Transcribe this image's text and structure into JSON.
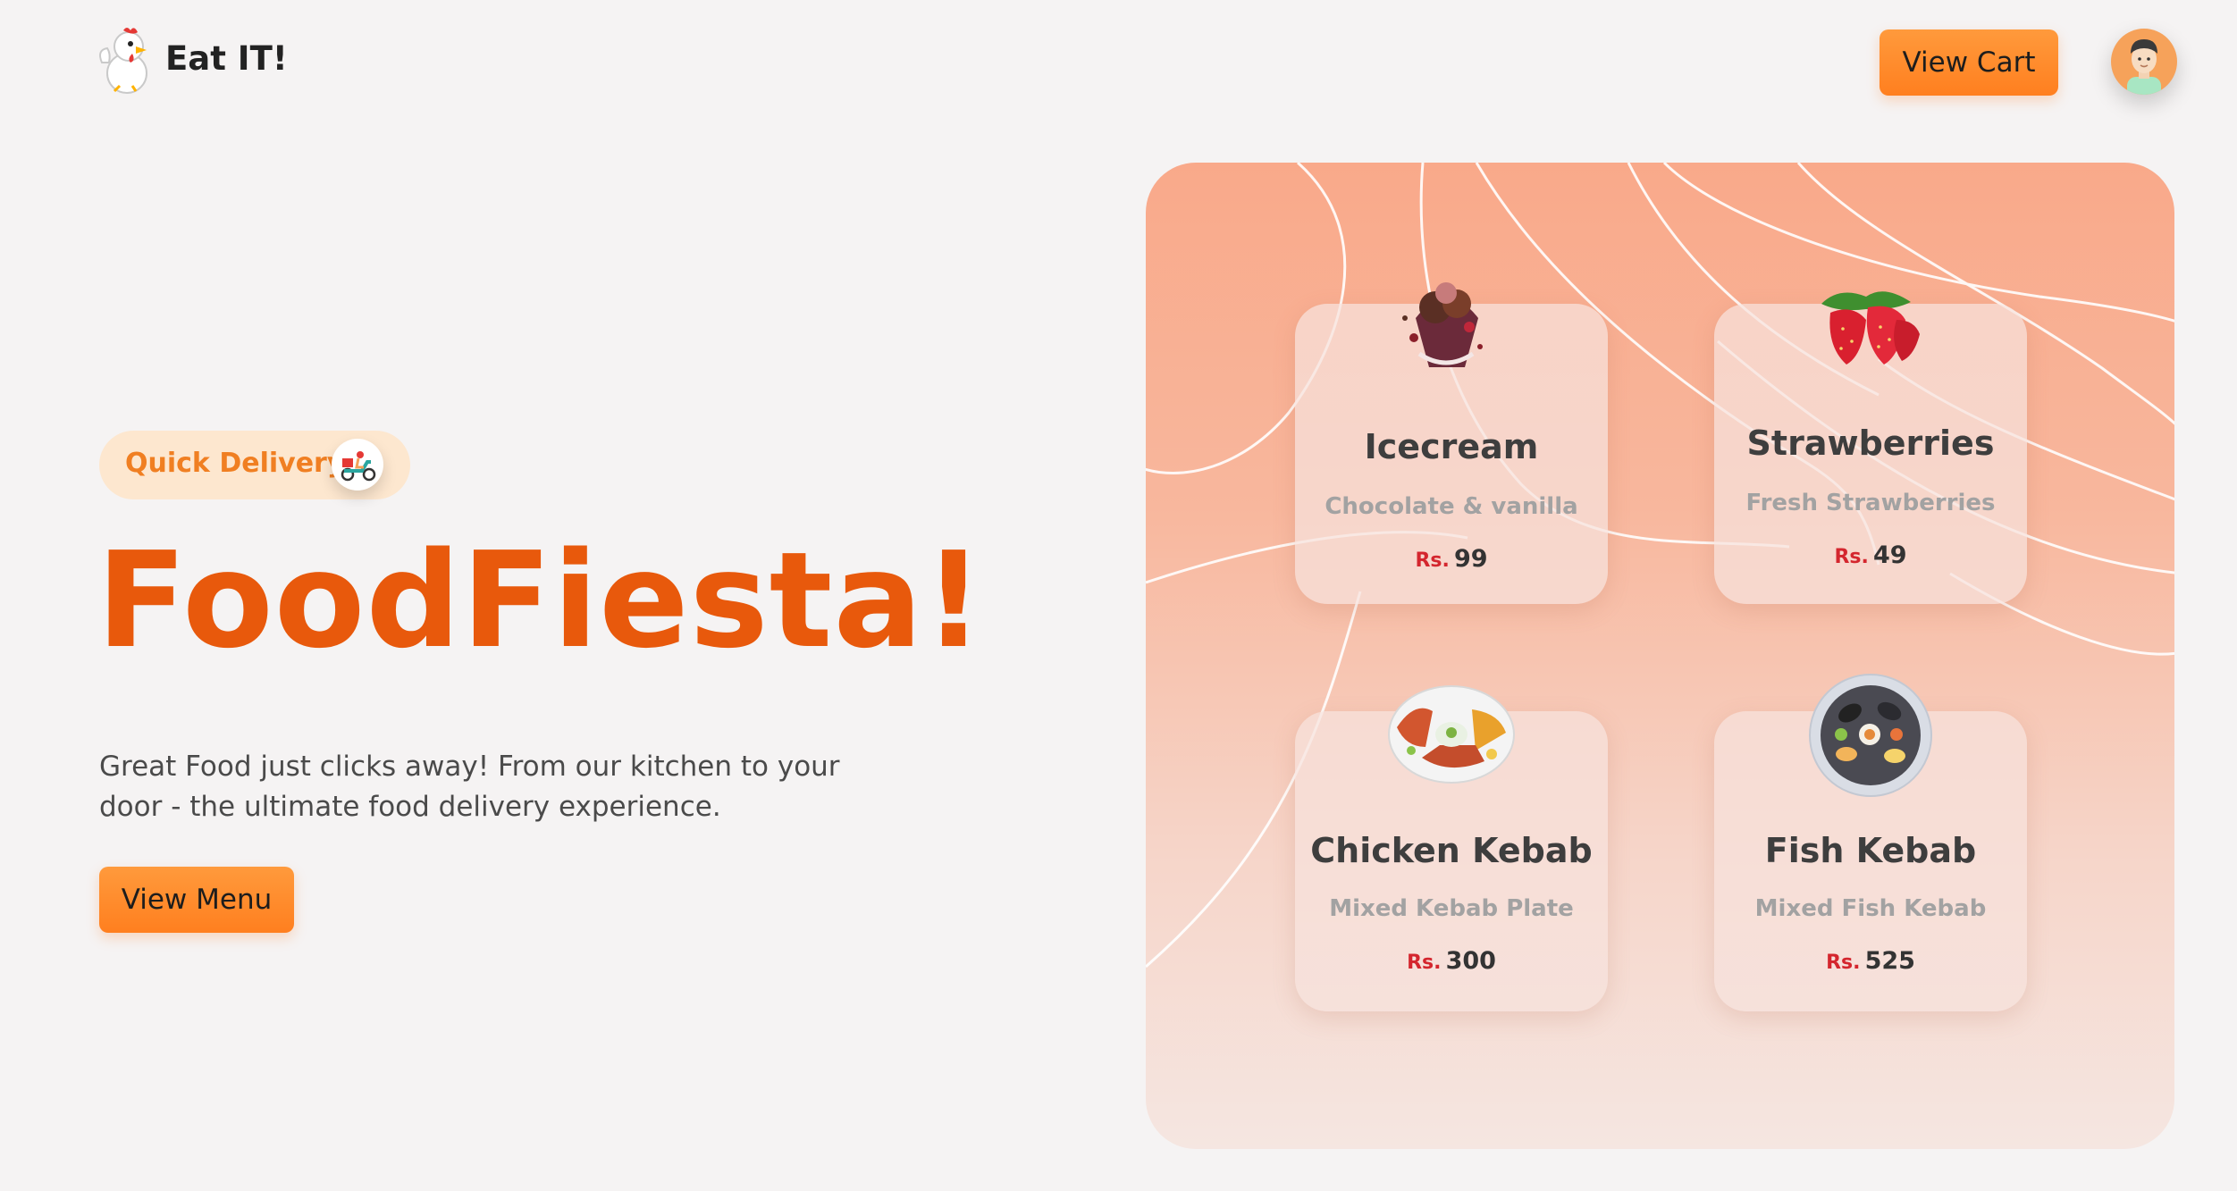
{
  "header": {
    "brand": "Eat IT!",
    "cart_label": "View Cart"
  },
  "hero": {
    "badge_label": "Quick Delivery",
    "title": "FoodFiesta!",
    "description": "Great Food just clicks away! From our kitchen to your door - the ultimate food delivery experience.",
    "menu_button": "View Menu"
  },
  "cards": [
    {
      "name": "Icecream",
      "desc": "Chocolate & vanilla",
      "currency": "Rs.",
      "price": "99",
      "icon": "icecream-icon"
    },
    {
      "name": "Strawberries",
      "desc": "Fresh Strawberries",
      "currency": "Rs.",
      "price": "49",
      "icon": "strawberries-icon"
    },
    {
      "name": "Chicken Kebab",
      "desc": "Mixed Kebab Plate",
      "currency": "Rs.",
      "price": "300",
      "icon": "chicken-kebab-icon"
    },
    {
      "name": "Fish Kebab",
      "desc": "Mixed Fish Kebab",
      "currency": "Rs.",
      "price": "525",
      "icon": "fish-kebab-icon"
    }
  ],
  "colors": {
    "accent": "#ff8a2b",
    "title": "#e8590c",
    "price_currency": "#d4262e",
    "background": "#f5f3f3"
  }
}
